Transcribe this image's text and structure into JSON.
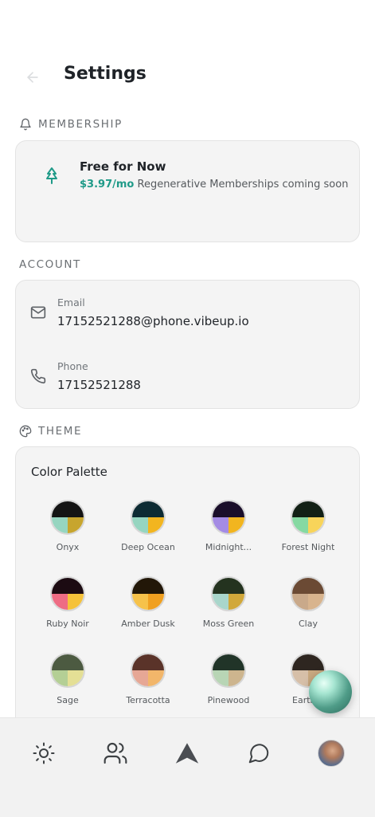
{
  "header": {
    "title": "Settings"
  },
  "membership": {
    "section_label": "MEMBERSHIP",
    "title": "Free for Now",
    "price": "$3.97/mo",
    "note": "Regenerative Memberships coming soon"
  },
  "account": {
    "section_label": "ACCOUNT",
    "email_label": "Email",
    "email_value": "17152521288@phone.vibeup.io",
    "phone_label": "Phone",
    "phone_value": "17152521288"
  },
  "theme": {
    "section_label": "THEME",
    "palette_title": "Color Palette",
    "palettes": [
      {
        "name": "Onyx",
        "colors": [
          "#141414",
          "#96d5c0",
          "#c7a52e"
        ]
      },
      {
        "name": "Deep Ocean",
        "colors": [
          "#0d2b33",
          "#96d5c0",
          "#f2b51f"
        ]
      },
      {
        "name": "Midnight...",
        "colors": [
          "#1a0e2a",
          "#a48be4",
          "#f2b51f"
        ]
      },
      {
        "name": "Forest Night",
        "colors": [
          "#122015",
          "#86d9a2",
          "#f8d45a"
        ]
      },
      {
        "name": "Ruby Noir",
        "colors": [
          "#1c0b12",
          "#ee6c84",
          "#f5c23a"
        ]
      },
      {
        "name": "Amber Dusk",
        "colors": [
          "#221708",
          "#f6c24a",
          "#f0a020"
        ]
      },
      {
        "name": "Moss Green",
        "colors": [
          "#24331f",
          "#a9d6cb",
          "#d1a83a"
        ]
      },
      {
        "name": "Clay",
        "colors": [
          "#6b4a34",
          "#c9a98a",
          "#d8b48e"
        ]
      },
      {
        "name": "Sage",
        "colors": [
          "#4c5a41",
          "#b4cf95",
          "#e4df95"
        ]
      },
      {
        "name": "Terracotta",
        "colors": [
          "#5a3329",
          "#e6a795",
          "#f2b66a"
        ]
      },
      {
        "name": "Pinewood",
        "colors": [
          "#213428",
          "#b8d5b5",
          "#cdb58e"
        ]
      },
      {
        "name": "Earth E",
        "colors": [
          "#2e2620",
          "#d6bfa8",
          "#c8a87f"
        ]
      }
    ]
  },
  "nav": {
    "items": [
      "sun-icon",
      "users-icon",
      "triangle-logo-icon",
      "chat-icon",
      "profile-avatar"
    ]
  }
}
